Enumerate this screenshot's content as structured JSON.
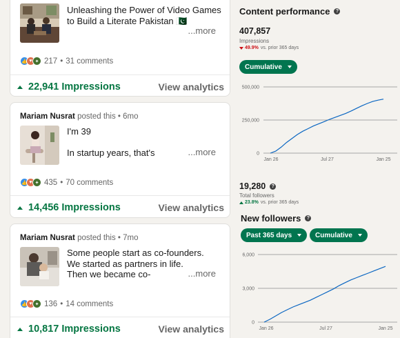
{
  "feed": {
    "posts": [
      {
        "text_lines": [
          "Unleashing the Power of Video Games",
          "to Build a Literate Pakistan 🇵🇰"
        ],
        "more": "...more",
        "reactions_count": "217",
        "comments": "31 comments",
        "impressions": "22,941 Impressions",
        "view_analytics": "View analytics"
      },
      {
        "author": "Mariam Nusrat",
        "posted": "posted this",
        "age": "6mo",
        "text_lines": [
          "I'm 39",
          "",
          "In startup years, that's"
        ],
        "more": "...more",
        "reactions_count": "435",
        "comments": "70 comments",
        "impressions": "14,456 Impressions",
        "view_analytics": "View analytics"
      },
      {
        "author": "Mariam Nusrat",
        "posted": "posted this",
        "age": "7mo",
        "text_lines": [
          "Some people start as co-founders.",
          "We started as partners in life.",
          "Then we became co-"
        ],
        "more": "...more",
        "reactions_count": "136",
        "comments": "14 comments",
        "impressions": "10,817 Impressions",
        "view_analytics": "View analytics"
      }
    ],
    "separator": "•"
  },
  "panel": {
    "content_performance": {
      "title": "Content performance",
      "value": "407,857",
      "label": "Impressions",
      "delta": "49.9%",
      "delta_suffix": "vs. prior 365 days",
      "delta_direction": "down",
      "filter": "Cumulative"
    },
    "followers": {
      "value": "19,280",
      "label": "Total followers",
      "delta": "23.8%",
      "delta_suffix": "vs. prior 365 days",
      "delta_direction": "up",
      "title": "New followers",
      "filter_period": "Past 365 days",
      "filter_mode": "Cumulative"
    }
  },
  "colors": {
    "positive": "#057642",
    "negative": "#cc1016",
    "pill_bg": "#01754f",
    "line": "#0a66c2"
  },
  "chart_data": [
    {
      "type": "line",
      "title": "",
      "xlabel": "",
      "ylabel": "",
      "x_ticks": [
        "Jan 26",
        "Jul 27",
        "Jan 25"
      ],
      "y_ticks": [
        "0",
        "250,000",
        "500,000"
      ],
      "ylim": [
        0,
        500000
      ],
      "grid": true,
      "series": [
        {
          "values": [
            0,
            15000,
            45000,
            80000,
            110000,
            140000,
            165000,
            185000,
            205000,
            222000,
            238000,
            255000,
            270000,
            285000,
            300000,
            318000,
            338000,
            358000,
            375000,
            390000,
            400000,
            408000
          ]
        }
      ]
    },
    {
      "type": "line",
      "title": "",
      "xlabel": "",
      "ylabel": "",
      "x_ticks": [
        "Jan 26",
        "Jul 27",
        "Jan 25"
      ],
      "y_ticks": [
        "0",
        "3,000",
        "6,000"
      ],
      "ylim": [
        0,
        6000
      ],
      "grid": true,
      "series": [
        {
          "values": [
            0,
            250,
            550,
            850,
            1100,
            1350,
            1550,
            1750,
            1950,
            2200,
            2450,
            2700,
            2950,
            3250,
            3500,
            3750,
            3950,
            4150,
            4350,
            4550,
            4750,
            4950
          ]
        }
      ]
    }
  ]
}
